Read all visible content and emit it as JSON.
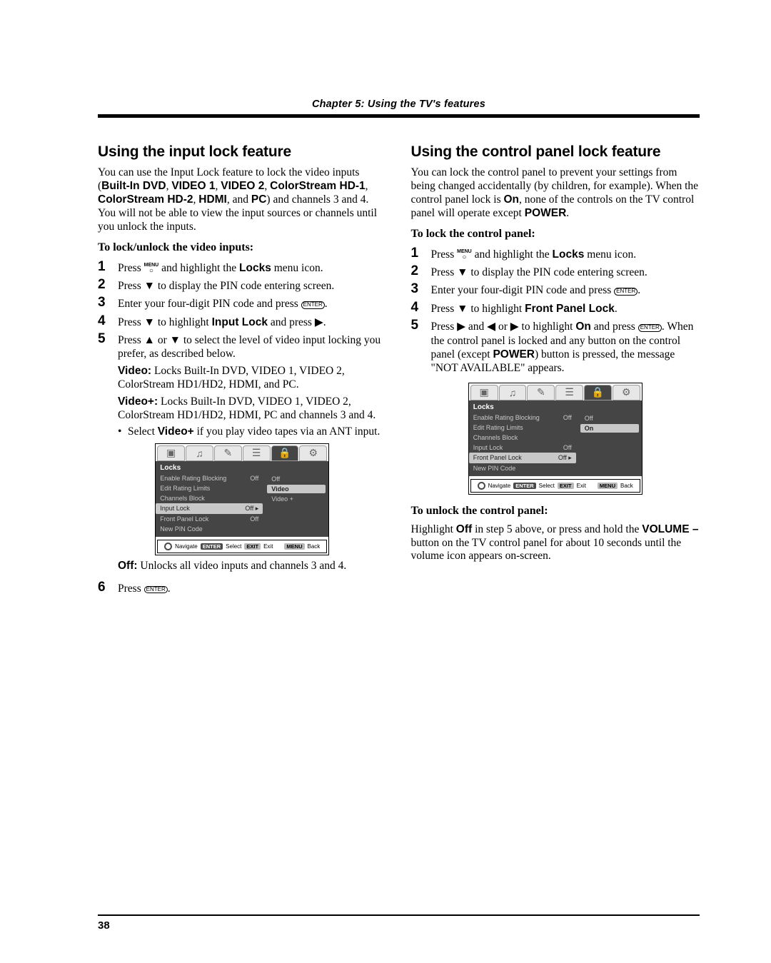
{
  "chapter_header": "Chapter 5: Using the TV's features",
  "page_number": "38",
  "left": {
    "title": "Using the input lock feature",
    "intro_a": "You can use the Input Lock feature to lock the video inputs (",
    "intro_inputs": [
      "Built-In DVD",
      "VIDEO 1",
      "VIDEO 2",
      "ColorStream HD-1",
      "ColorStream HD-2",
      "HDMI",
      "PC"
    ],
    "intro_b": ") and channels 3 and 4. You will not be able to view the input sources or channels until you unlock the inputs.",
    "subhead": "To lock/unlock the video inputs:",
    "step1_a": "Press ",
    "step1_b": " and highlight the ",
    "step1_c": " menu icon.",
    "step1_menu": "Locks",
    "step2": "Press ▼ to display the PIN code entering screen.",
    "step3_a": "Enter your four-digit PIN code and press ",
    "step3_b": ".",
    "step4_a": "Press ▼ to highlight ",
    "step4_lock": "Input Lock",
    "step4_b": " and press ▶.",
    "step5_a": "Press ▲ or ▼ to select the level of video input locking you prefer, as described below.",
    "step5_video_label": "Video:",
    "step5_video_txt": " Locks Built-In DVD, VIDEO 1, VIDEO 2, ColorStream HD1/HD2, HDMI, and PC.",
    "step5_videoplus_label": "Video+:",
    "step5_videoplus_txt": " Locks Built-In DVD, VIDEO 1, VIDEO 2, ColorStream HD1/HD2, HDMI, PC and channels 3 and 4.",
    "step5_bullet_a": "Select ",
    "step5_bullet_label": "Video+",
    "step5_bullet_b": " if you play video tapes via an ANT input.",
    "off_label": "Off:",
    "off_txt": " Unlocks all video inputs and channels 3 and 4.",
    "step6_a": "Press ",
    "step6_b": "."
  },
  "right": {
    "title": "Using the control panel lock feature",
    "intro_a": "You can lock the control panel to prevent your settings from being changed accidentally (by children, for example). When the control panel lock is ",
    "intro_on": "On",
    "intro_b": ", none of the controls on the TV control panel will operate except ",
    "intro_power": "POWER",
    "intro_c": ".",
    "subhead": "To lock the control panel:",
    "step1_a": "Press ",
    "step1_b": " and highlight the ",
    "step1_c": " menu icon.",
    "step1_menu": "Locks",
    "step2": "Press ▼ to display the PIN code entering screen.",
    "step3_a": "Enter your four-digit PIN code and press ",
    "step3_b": ".",
    "step4_a": "Press ▼ to highlight ",
    "step4_lock": "Front Panel Lock",
    "step4_b": ".",
    "step5_a": "Press ▶ and ◀ or ▶ to highlight ",
    "step5_on": "On",
    "step5_b": " and press ",
    "step5_c": ". When the control panel is locked and any button on the control panel (except ",
    "step5_power": "POWER",
    "step5_d": ") button is pressed, the message \"NOT AVAILABLE\" appears.",
    "unlock_head": "To unlock the control panel:",
    "unlock_a": "Highlight ",
    "unlock_off": "Off",
    "unlock_b": " in step 5 above, or press and hold the ",
    "unlock_vol": "VOLUME –",
    "unlock_c": " button on the TV control panel for about 10 seconds until the volume icon appears on-screen."
  },
  "osd1": {
    "title": "Locks",
    "rows": [
      {
        "label": "Enable Rating Blocking",
        "val": "Off"
      },
      {
        "label": "Edit Rating Limits",
        "val": ""
      },
      {
        "label": "Channels Block",
        "val": ""
      },
      {
        "label": "Input Lock",
        "val": "Off  ▸",
        "sel": true
      },
      {
        "label": "Front Panel Lock",
        "val": "Off"
      },
      {
        "label": "New PIN Code",
        "val": ""
      }
    ],
    "options": [
      "Off",
      "Video",
      "Video +"
    ],
    "selected_option": "Video",
    "footer": {
      "nav": "Navigate",
      "select": "Select",
      "exit": "Exit",
      "back": "Back",
      "enter": "ENTER",
      "exit_k": "EXIT",
      "menu_k": "MENU"
    }
  },
  "osd2": {
    "title": "Locks",
    "rows": [
      {
        "label": "Enable Rating Blocking",
        "val": "Off"
      },
      {
        "label": "Edit Rating Limits",
        "val": ""
      },
      {
        "label": "Channels Block",
        "val": ""
      },
      {
        "label": "Input Lock",
        "val": "Off"
      },
      {
        "label": "Front Panel Lock",
        "val": "Off  ▸",
        "sel": true
      },
      {
        "label": "New PIN Code",
        "val": ""
      }
    ],
    "options": [
      "Off",
      "On"
    ],
    "selected_option": "On",
    "footer": {
      "nav": "Navigate",
      "select": "Select",
      "exit": "Exit",
      "back": "Back",
      "enter": "ENTER",
      "exit_k": "EXIT",
      "menu_k": "MENU"
    }
  },
  "icons": {
    "menu_label": "MENU",
    "enter_label": "ENTER"
  }
}
